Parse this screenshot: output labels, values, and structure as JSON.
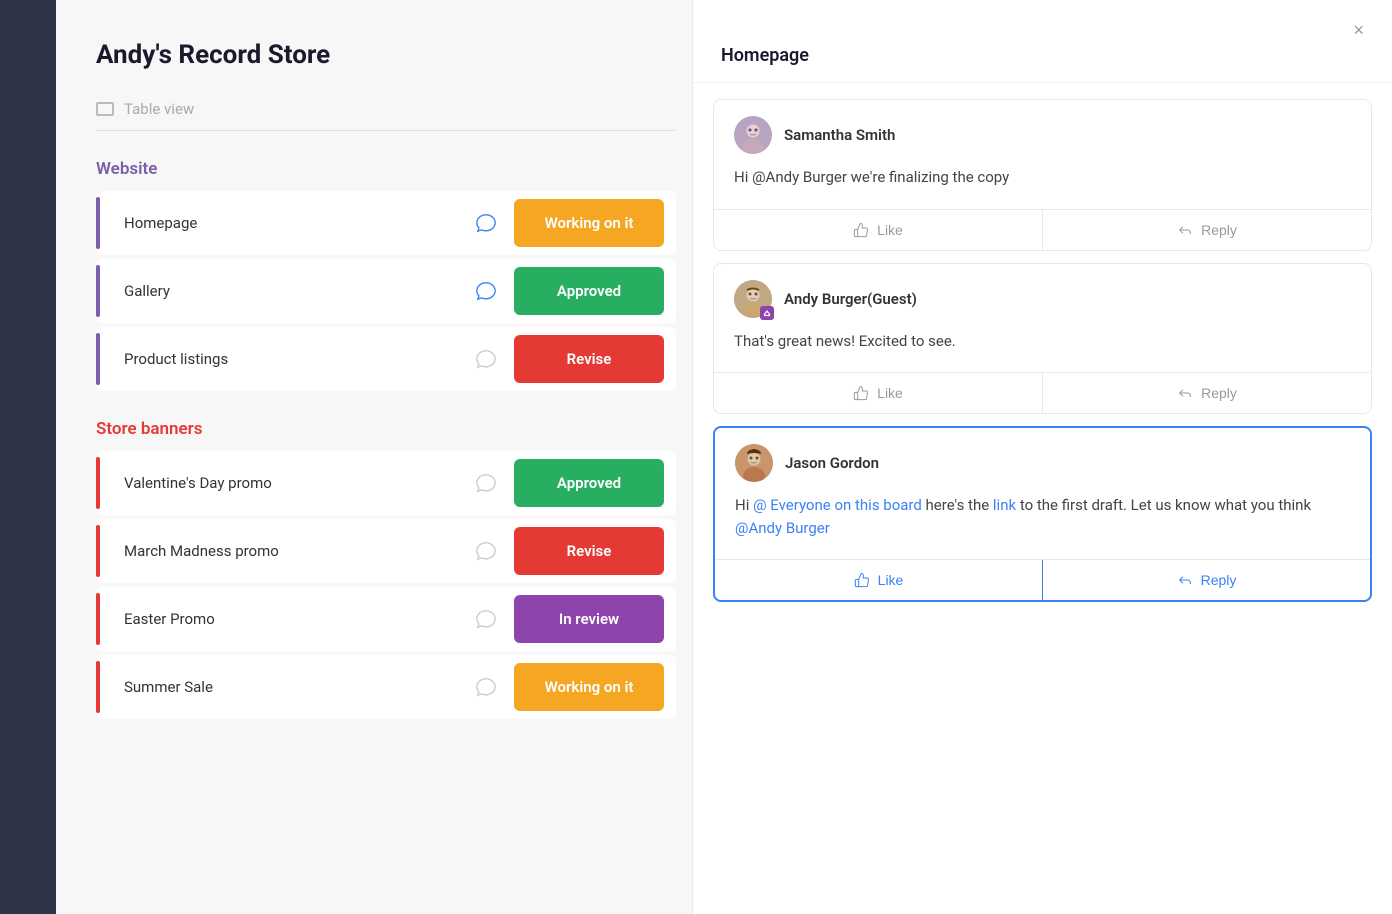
{
  "sidebar": {
    "background": "#2d3448"
  },
  "header": {
    "title": "Andy's Record Store",
    "view_toggle_label": "Table view"
  },
  "website_section": {
    "title": "Website",
    "items": [
      {
        "name": "Homepage",
        "status": "Working on it",
        "status_class": "badge-orange",
        "has_chat": true,
        "chat_active": true,
        "border_color": "purple"
      },
      {
        "name": "Gallery",
        "status": "Approved",
        "status_class": "badge-green",
        "has_chat": true,
        "chat_active": true,
        "border_color": "purple"
      },
      {
        "name": "Product listings",
        "status": "Revise",
        "status_class": "badge-red",
        "has_chat": true,
        "chat_active": false,
        "border_color": "purple"
      }
    ]
  },
  "store_banners_section": {
    "title": "Store banners",
    "items": [
      {
        "name": "Valentine's Day promo",
        "status": "Approved",
        "status_class": "badge-green",
        "has_chat": true,
        "chat_active": false,
        "border_color": "red"
      },
      {
        "name": "March Madness promo",
        "status": "Revise",
        "status_class": "badge-red",
        "has_chat": true,
        "chat_active": false,
        "border_color": "red"
      },
      {
        "name": "Easter Promo",
        "status": "In review",
        "status_class": "badge-purple",
        "has_chat": true,
        "chat_active": false,
        "border_color": "red"
      },
      {
        "name": "Summer Sale",
        "status": "Working on it",
        "status_class": "badge-orange",
        "has_chat": true,
        "chat_active": false,
        "border_color": "red"
      }
    ]
  },
  "comment_panel": {
    "title": "Homepage",
    "close_label": "×",
    "comments": [
      {
        "author": "Samantha Smith",
        "avatar_type": "samantha",
        "text": "Hi @Andy Burger we're finalizing the copy",
        "like_label": "Like",
        "reply_label": "Reply",
        "is_active": false
      },
      {
        "author": "Andy Burger(Guest)",
        "avatar_type": "andy",
        "text": "That's great news! Excited to see.",
        "like_label": "Like",
        "reply_label": "Reply",
        "is_active": false
      },
      {
        "author": "Jason Gordon",
        "avatar_type": "jason",
        "text_pre": "Hi ",
        "mention1": "@ Everyone on this board",
        "text_mid": " here's the ",
        "link": "link",
        "text_post": " to the first draft. Let us know what you think ",
        "mention2": "@Andy Burger",
        "like_label": "Like",
        "reply_label": "Reply",
        "is_active": true
      }
    ]
  }
}
